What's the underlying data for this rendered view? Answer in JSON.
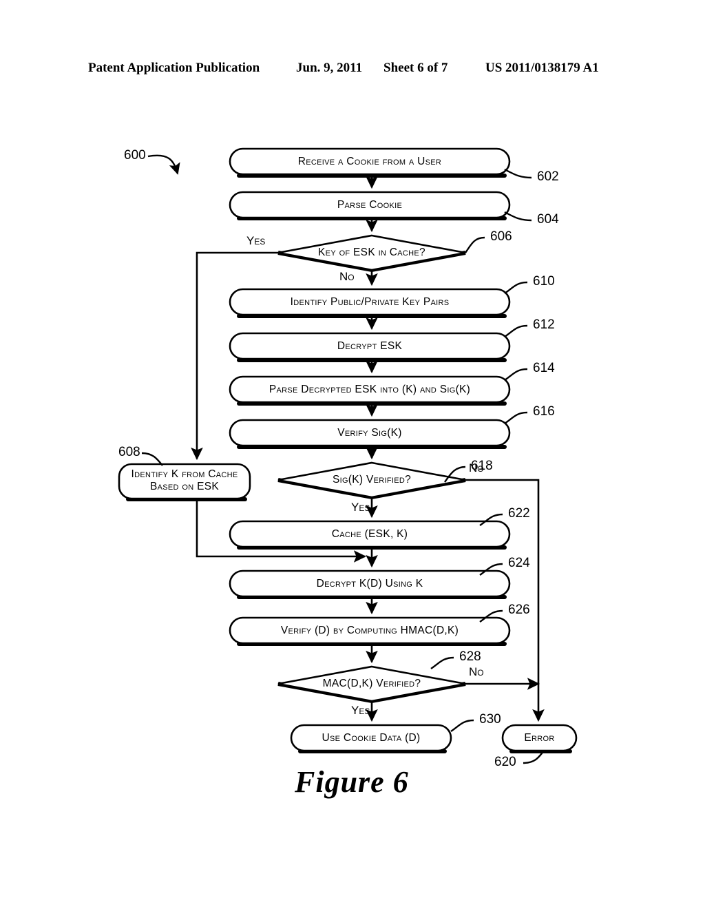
{
  "header": {
    "publication": "Patent Application Publication",
    "date": "Jun. 9, 2011",
    "sheet": "Sheet 6 of 7",
    "number": "US 2011/0138179 A1"
  },
  "figure": {
    "caption": "Figure 6",
    "diagram_ref": "600",
    "type": "flowchart",
    "nodes": [
      {
        "id": "602",
        "ref": "602",
        "shape": "rounded-rect",
        "label": "Receive a Cookie from a User"
      },
      {
        "id": "604",
        "ref": "604",
        "shape": "rounded-rect",
        "label": "Parse Cookie"
      },
      {
        "id": "606",
        "ref": "606",
        "shape": "diamond",
        "label": "Key of ESK in Cache?"
      },
      {
        "id": "608",
        "ref": "608",
        "shape": "rounded-rect",
        "label": "Identify K from Cache Based on ESK",
        "line1": "Identify K from Cache",
        "line2": "Based on ESK"
      },
      {
        "id": "610",
        "ref": "610",
        "shape": "rounded-rect",
        "label": "Identify Public/Private Key Pairs"
      },
      {
        "id": "612",
        "ref": "612",
        "shape": "rounded-rect",
        "label": "Decrypt ESK"
      },
      {
        "id": "614",
        "ref": "614",
        "shape": "rounded-rect",
        "label": "Parse Decrypted ESK into (K) and Sig(K)"
      },
      {
        "id": "616",
        "ref": "616",
        "shape": "rounded-rect",
        "label": "Verify Sig(K)"
      },
      {
        "id": "618",
        "ref": "618",
        "shape": "diamond",
        "label": "Sig(K) Verified?"
      },
      {
        "id": "620",
        "ref": "620",
        "shape": "rounded-rect",
        "label": "Error"
      },
      {
        "id": "622",
        "ref": "622",
        "shape": "rounded-rect",
        "label": "Cache (ESK, K)"
      },
      {
        "id": "624",
        "ref": "624",
        "shape": "rounded-rect",
        "label": "Decrypt K(D) Using K"
      },
      {
        "id": "626",
        "ref": "626",
        "shape": "rounded-rect",
        "label": "Verify (D) by Computing HMAC(D,K)"
      },
      {
        "id": "628",
        "ref": "628",
        "shape": "diamond",
        "label": "MAC(D,K) Verified?"
      },
      {
        "id": "630",
        "ref": "630",
        "shape": "rounded-rect",
        "label": "Use Cookie Data (D)"
      }
    ],
    "branch_labels": {
      "d606_yes": "Yes",
      "d606_no": "No",
      "d618_yes": "Yes",
      "d618_no": "No",
      "d628_yes": "Yes",
      "d628_no": "No"
    }
  },
  "colors": {
    "ink": "#000000",
    "paper": "#ffffff"
  }
}
